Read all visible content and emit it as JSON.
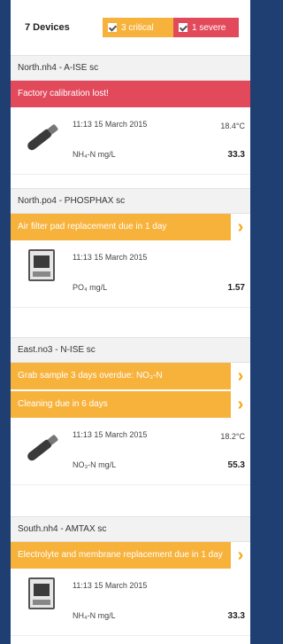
{
  "header": {
    "device_count": "7 Devices",
    "critical_label": "3 critical",
    "severe_label": "1 severe"
  },
  "colors": {
    "critical": "#f7b23c",
    "severe": "#e24a5c",
    "background": "#1f3f73"
  },
  "devices": [
    {
      "name": "North.nh4 - A-ISE sc",
      "icon": "probe-sensor-icon",
      "alarms": [
        {
          "text": "Factory calibration lost!",
          "severity": "severe",
          "has_arrow": false
        }
      ],
      "timestamp": "11:13 15 March 2015",
      "side_value": "18.4°C",
      "parameter": "NH₄-N mg/L",
      "value": "33.3"
    },
    {
      "name": "North.po4 - PHOSPHAX sc",
      "icon": "analyzer-icon",
      "alarms": [
        {
          "text": "Air filter pad replacement due in 1 day",
          "severity": "critical",
          "has_arrow": true
        }
      ],
      "timestamp": "11:13 15 March 2015",
      "side_value": "",
      "parameter": "PO₄ mg/L",
      "value": "1.57"
    },
    {
      "name": "East.no3 - N-ISE sc",
      "icon": "probe-sensor-icon",
      "alarms": [
        {
          "text": "Grab sample 3 days overdue: NO₃-N",
          "severity": "critical",
          "has_arrow": true
        },
        {
          "text": "Cleaning due in 6 days",
          "severity": "critical",
          "has_arrow": true
        }
      ],
      "timestamp": "11:13 15 March 2015",
      "side_value": "18.2°C",
      "parameter": "NO₃-N mg/L",
      "value": "55.3"
    },
    {
      "name": "South.nh4 - AMTAX sc",
      "icon": "analyzer-icon",
      "alarms": [
        {
          "text": "Electrolyte and membrane replacement due in 1 day",
          "severity": "critical",
          "has_arrow": true
        }
      ],
      "timestamp": "11:13 15 March 2015",
      "side_value": "",
      "parameter": "NH₄-N mg/L",
      "value": "33.3"
    }
  ]
}
